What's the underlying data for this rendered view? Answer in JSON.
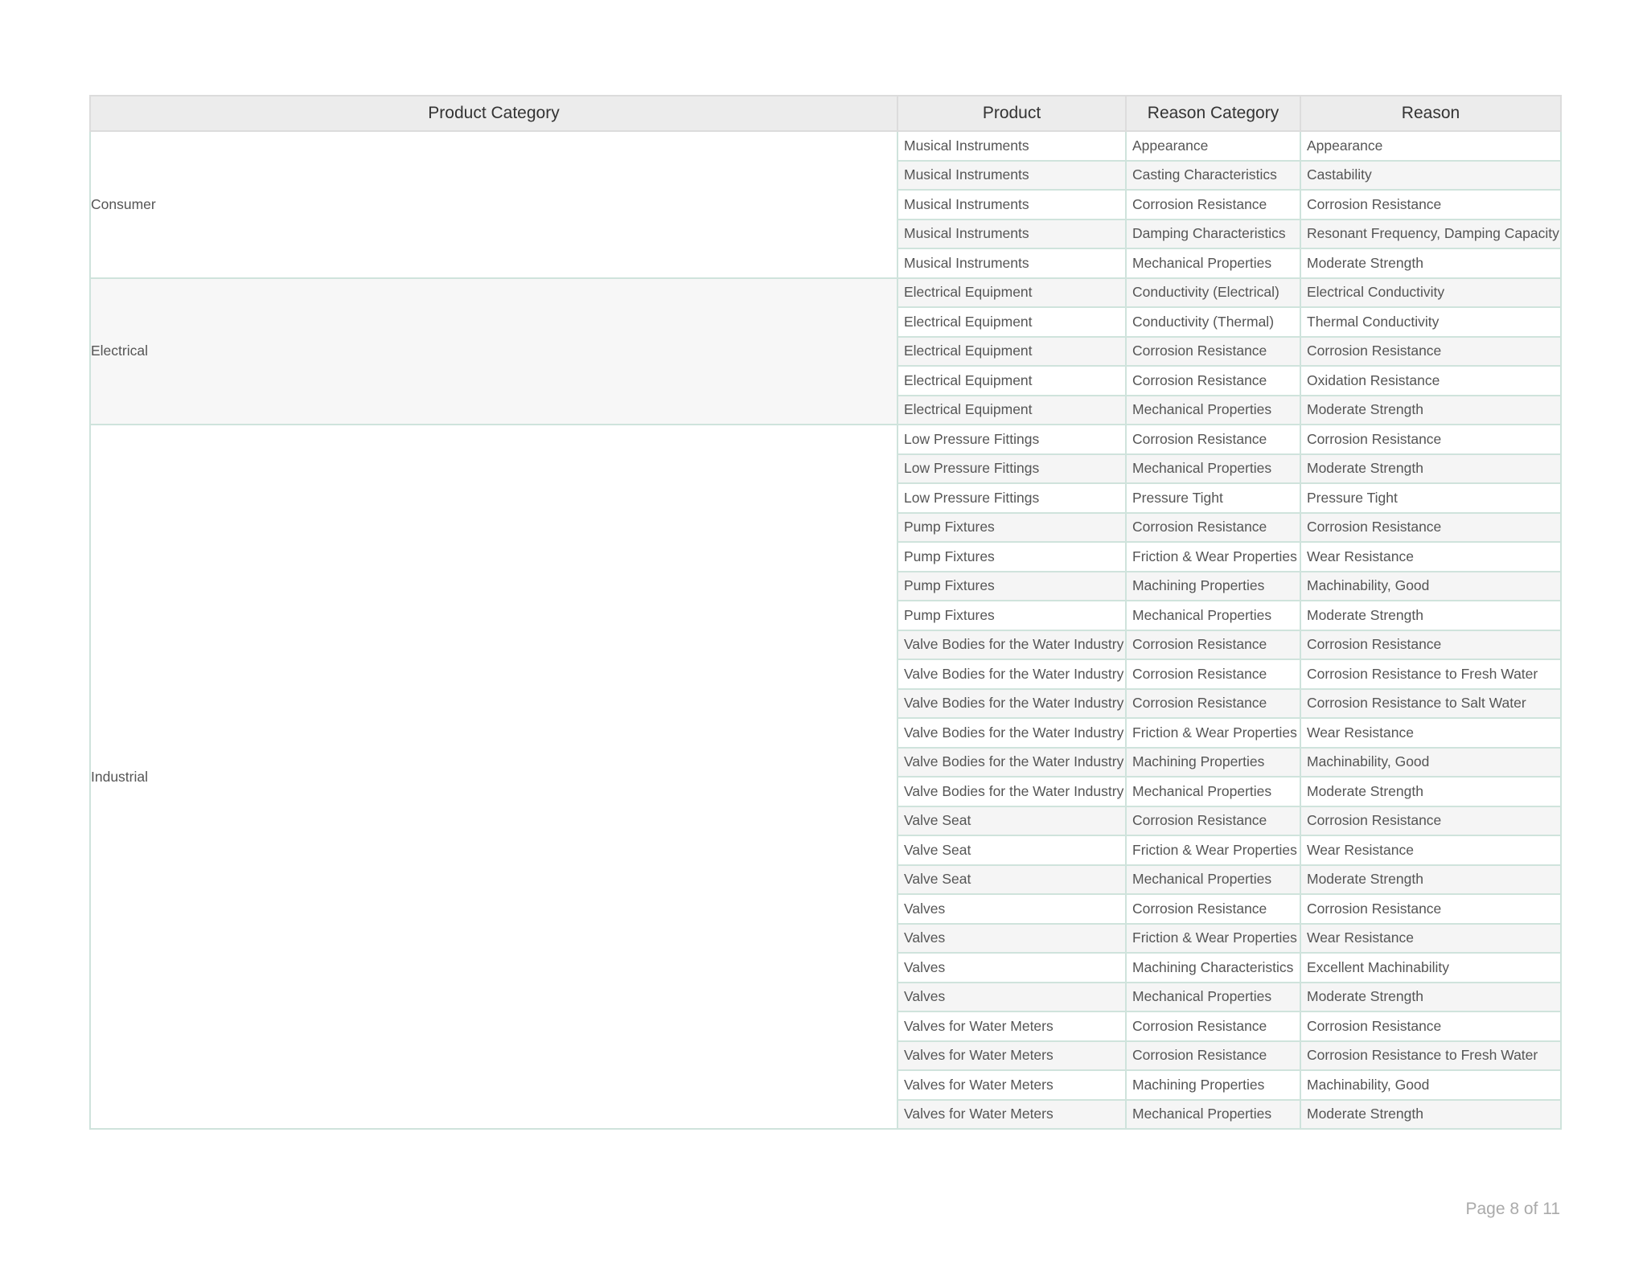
{
  "table": {
    "headers": [
      "Product Category",
      "Product",
      "Reason Category",
      "Reason"
    ],
    "groups": [
      {
        "category": "Consumer",
        "rows": [
          [
            "Musical Instruments",
            "Appearance",
            "Appearance"
          ],
          [
            "Musical Instruments",
            "Casting Characteristics",
            "Castability"
          ],
          [
            "Musical Instruments",
            "Corrosion Resistance",
            "Corrosion Resistance"
          ],
          [
            "Musical Instruments",
            "Damping Characteristics",
            "Resonant Frequency, Damping Capacity"
          ],
          [
            "Musical Instruments",
            "Mechanical Properties",
            "Moderate Strength"
          ]
        ]
      },
      {
        "category": "Electrical",
        "rows": [
          [
            "Electrical Equipment",
            "Conductivity (Electrical)",
            "Electrical Conductivity"
          ],
          [
            "Electrical Equipment",
            "Conductivity (Thermal)",
            "Thermal Conductivity"
          ],
          [
            "Electrical Equipment",
            "Corrosion Resistance",
            "Corrosion Resistance"
          ],
          [
            "Electrical Equipment",
            "Corrosion Resistance",
            "Oxidation Resistance"
          ],
          [
            "Electrical Equipment",
            "Mechanical Properties",
            "Moderate Strength"
          ]
        ]
      },
      {
        "category": "Industrial",
        "rows": [
          [
            "Low Pressure Fittings",
            "Corrosion Resistance",
            "Corrosion Resistance"
          ],
          [
            "Low Pressure Fittings",
            "Mechanical Properties",
            "Moderate Strength"
          ],
          [
            "Low Pressure Fittings",
            "Pressure Tight",
            "Pressure Tight"
          ],
          [
            "Pump Fixtures",
            "Corrosion Resistance",
            "Corrosion Resistance"
          ],
          [
            "Pump Fixtures",
            "Friction & Wear Properties",
            "Wear Resistance"
          ],
          [
            "Pump Fixtures",
            "Machining Properties",
            "Machinability, Good"
          ],
          [
            "Pump Fixtures",
            "Mechanical Properties",
            "Moderate Strength"
          ],
          [
            "Valve Bodies for the Water Industry",
            "Corrosion Resistance",
            "Corrosion Resistance"
          ],
          [
            "Valve Bodies for the Water Industry",
            "Corrosion Resistance",
            "Corrosion Resistance to Fresh Water"
          ],
          [
            "Valve Bodies for the Water Industry",
            "Corrosion Resistance",
            "Corrosion Resistance to Salt Water"
          ],
          [
            "Valve Bodies for the Water Industry",
            "Friction & Wear Properties",
            "Wear Resistance"
          ],
          [
            "Valve Bodies for the Water Industry",
            "Machining Properties",
            "Machinability, Good"
          ],
          [
            "Valve Bodies for the Water Industry",
            "Mechanical Properties",
            "Moderate Strength"
          ],
          [
            "Valve Seat",
            "Corrosion Resistance",
            "Corrosion Resistance"
          ],
          [
            "Valve Seat",
            "Friction & Wear Properties",
            "Wear Resistance"
          ],
          [
            "Valve Seat",
            "Mechanical Properties",
            "Moderate Strength"
          ],
          [
            "Valves",
            "Corrosion Resistance",
            "Corrosion Resistance"
          ],
          [
            "Valves",
            "Friction & Wear Properties",
            "Wear Resistance"
          ],
          [
            "Valves",
            "Machining Characteristics",
            "Excellent Machinability"
          ],
          [
            "Valves",
            "Mechanical Properties",
            "Moderate Strength"
          ],
          [
            "Valves for Water Meters",
            "Corrosion Resistance",
            "Corrosion Resistance"
          ],
          [
            "Valves for Water Meters",
            "Corrosion Resistance",
            "Corrosion Resistance to Fresh Water"
          ],
          [
            "Valves for Water Meters",
            "Machining Properties",
            "Machinability, Good"
          ],
          [
            "Valves for Water Meters",
            "Mechanical Properties",
            "Moderate Strength"
          ]
        ]
      }
    ]
  },
  "footer": {
    "page_label": "Page 8 of 11"
  },
  "colors": {
    "header_bg": "#ececec",
    "border": "#cfe3dc",
    "stripe": "#f5f5f5",
    "text": "#555555"
  }
}
